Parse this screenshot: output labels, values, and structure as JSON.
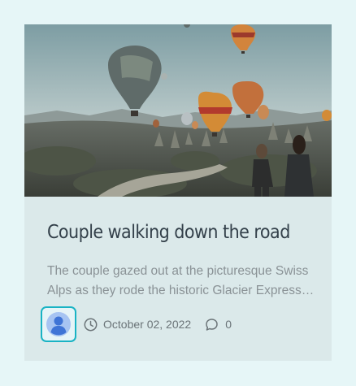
{
  "post": {
    "image_alt": "Hot air balloons over a valley at dusk with two people walking",
    "title": "Couple walking down the road",
    "excerpt": "The couple gazed out at the picturesque Swiss Alps as they rode the historic Glacier Express train through the mountains.",
    "date": "October 02, 2022",
    "comments": "0"
  },
  "icons": {
    "avatar": "user-avatar-icon",
    "date": "clock-icon",
    "comments": "comment-bubble-icon"
  },
  "colors": {
    "page_bg": "#e6f6f7",
    "card_bg": "#dbe9ea",
    "title": "#33404a",
    "excerpt": "#8a9296",
    "accent": "#19b3c4"
  }
}
